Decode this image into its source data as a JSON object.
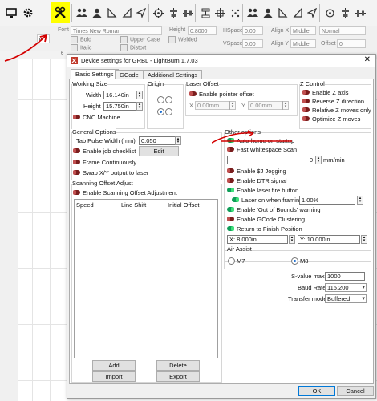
{
  "toolbar": {
    "icons": [
      "monitor-icon",
      "gear-icon",
      "tools-icon",
      "group-icon",
      "user-icon",
      "align-left-icon",
      "align-right-icon",
      "triangle-icon",
      "send-icon",
      "target-icon",
      "center-icon",
      "distribute-icon",
      "distribute-v-icon",
      "grid-icon",
      "dots-icon",
      "group2-icon",
      "user2-icon",
      "align-icon",
      "flip-icon",
      "triangle2-icon",
      "send2-icon",
      "target2-icon"
    ]
  },
  "fontbar": {
    "font_label": "Font",
    "font_value": "Times New Roman",
    "height_label": "Height",
    "height_value": "0.8000",
    "hspace_label": "HSpace",
    "hspace_value": "0.00",
    "vspace_label": "VSpace",
    "vspace_value": "0.00",
    "alignx_label": "Align X",
    "alignx_value": "Middle",
    "aligny_label": "Align Y",
    "aligny_value": "Middle",
    "normal": "Normal",
    "offset_label": "Offset",
    "offset_value": "0",
    "bold": "Bold",
    "italic": "Italic",
    "upper_case": "Upper Case",
    "distort": "Distort",
    "welded": "Welded",
    "unit": "in",
    "ruler_tick": "6"
  },
  "dialog": {
    "title": "Device settings for GRBL - LightBurn 1.7.03",
    "close": "✕",
    "tabs": [
      "Basic Settings",
      "GCode",
      "Additional Settings"
    ],
    "working_size": {
      "title": "Working Size",
      "width_label": "Width",
      "width_value": "16.140in",
      "height_label": "Height",
      "height_value": "15.750in",
      "cnc_label": "CNC Machine"
    },
    "origin": {
      "title": "Origin"
    },
    "laser_offset": {
      "title": "Laser Offset",
      "enable_label": "Enable pointer offset",
      "x_label": "X",
      "x_value": "0.00mm",
      "y_label": "Y",
      "y_value": "0.00mm"
    },
    "z_control": {
      "title": "Z Control",
      "items": [
        "Enable Z axis",
        "Reverse Z direction",
        "Relative Z moves only",
        "Optimize Z moves"
      ]
    },
    "general": {
      "title": "General Options",
      "tab_pulse_label": "Tab Pulse Width (mm)",
      "tab_pulse_value": "0.050",
      "job_checklist": "Enable job checklist",
      "edit_button": "Edit",
      "frame_continuously": "Frame Continuously",
      "swap_xy": "Swap X/Y output to laser"
    },
    "scanning": {
      "title": "Scanning Offset Adjust",
      "enable": "Enable Scanning Offset Adjustment",
      "columns": [
        "Speed",
        "Line Shift",
        "Initial Offset"
      ],
      "add": "Add",
      "delete": "Delete",
      "import": "Import",
      "export": "Export"
    },
    "other": {
      "title": "Other options",
      "auto_home": "Auto-home on startup",
      "fast_whitespace": "Fast Whitespace Scan",
      "whitespace_value": "0",
      "whitespace_unit": "mm/min",
      "jogging": "Enable $J Jogging",
      "dtr": "Enable DTR signal",
      "fire_button": "Enable laser fire button",
      "laser_framing": "Laser on when framing",
      "laser_framing_value": "1.00%",
      "out_of_bounds": "Enable 'Out of Bounds' warning",
      "gcode_clustering": "Enable GCode Clustering",
      "return_finish": "Return to Finish Position",
      "x_finish": "X: 8.000in",
      "y_finish": "Y: 10.000in"
    },
    "air_assist": {
      "title": "Air Assist",
      "m7": "M7",
      "m8": "M8"
    },
    "svalue_label": "S-value max",
    "svalue": "1000",
    "baud_label": "Baud Rate",
    "baud": "115,200",
    "transfer_label": "Transfer mode",
    "transfer": "Buffered",
    "ok": "OK",
    "cancel": "Cancel"
  }
}
